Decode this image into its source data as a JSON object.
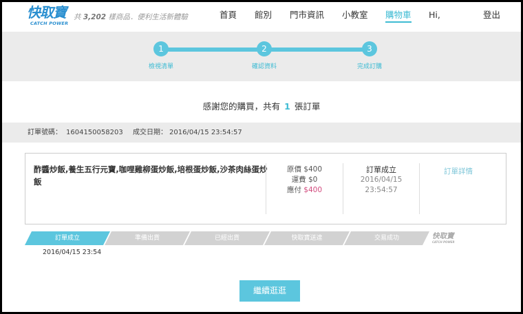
{
  "header": {
    "logo_main": "快取寶",
    "logo_sub": "CATCH POWER",
    "tagline_prefix": "共",
    "tagline_count": "3,202",
    "tagline_suffix": "樣商品．便利生活新體驗",
    "nav": [
      {
        "label": "首頁"
      },
      {
        "label": "館別"
      },
      {
        "label": "門市資訊"
      },
      {
        "label": "小教室"
      },
      {
        "label": "購物車"
      },
      {
        "label": "Hi,"
      },
      {
        "label": "登出"
      }
    ],
    "active_nav": "購物車"
  },
  "steps": [
    {
      "number": "1",
      "label": "檢視清單"
    },
    {
      "number": "2",
      "label": "確認資料"
    },
    {
      "number": "3",
      "label": "完成訂購"
    }
  ],
  "thanks": {
    "prefix": "感謝您的購買，共有",
    "count": "1",
    "suffix": "張訂單"
  },
  "order": {
    "number_label": "訂單號碼：",
    "number": "1604150058203",
    "date_label": "成交日期：",
    "date": "2016/04/15 23:54:57",
    "items": "酢醬炒飯,養生五行元寶,咖哩雞柳蛋炒飯,培根蛋炒飯,沙茶肉絲蛋炒飯",
    "price_label": "原價",
    "price": "$400",
    "shipping_label": "運費",
    "shipping": "$0",
    "due_label": "應付",
    "due": "$400",
    "status": "訂單成立",
    "status_date": "2016/04/15",
    "status_time": "23:54:57",
    "detail_link": "訂單詳情"
  },
  "progress": {
    "stages": [
      "訂單成立",
      "準備出貨",
      "已經出貨",
      "快取寶送達",
      "交易成功"
    ],
    "active_index": 0,
    "active_date": "2016/04/15 23:54",
    "mini_logo": "快取寶",
    "mini_logo_sub": "CATCH POWER"
  },
  "continue_label": "繼續逛逛",
  "colors": {
    "accent": "#5cc6de",
    "accent_text": "#3ebbd3",
    "brand": "#2a8fd0",
    "due": "#d24b7e",
    "inactive": "#d2d2d2"
  }
}
